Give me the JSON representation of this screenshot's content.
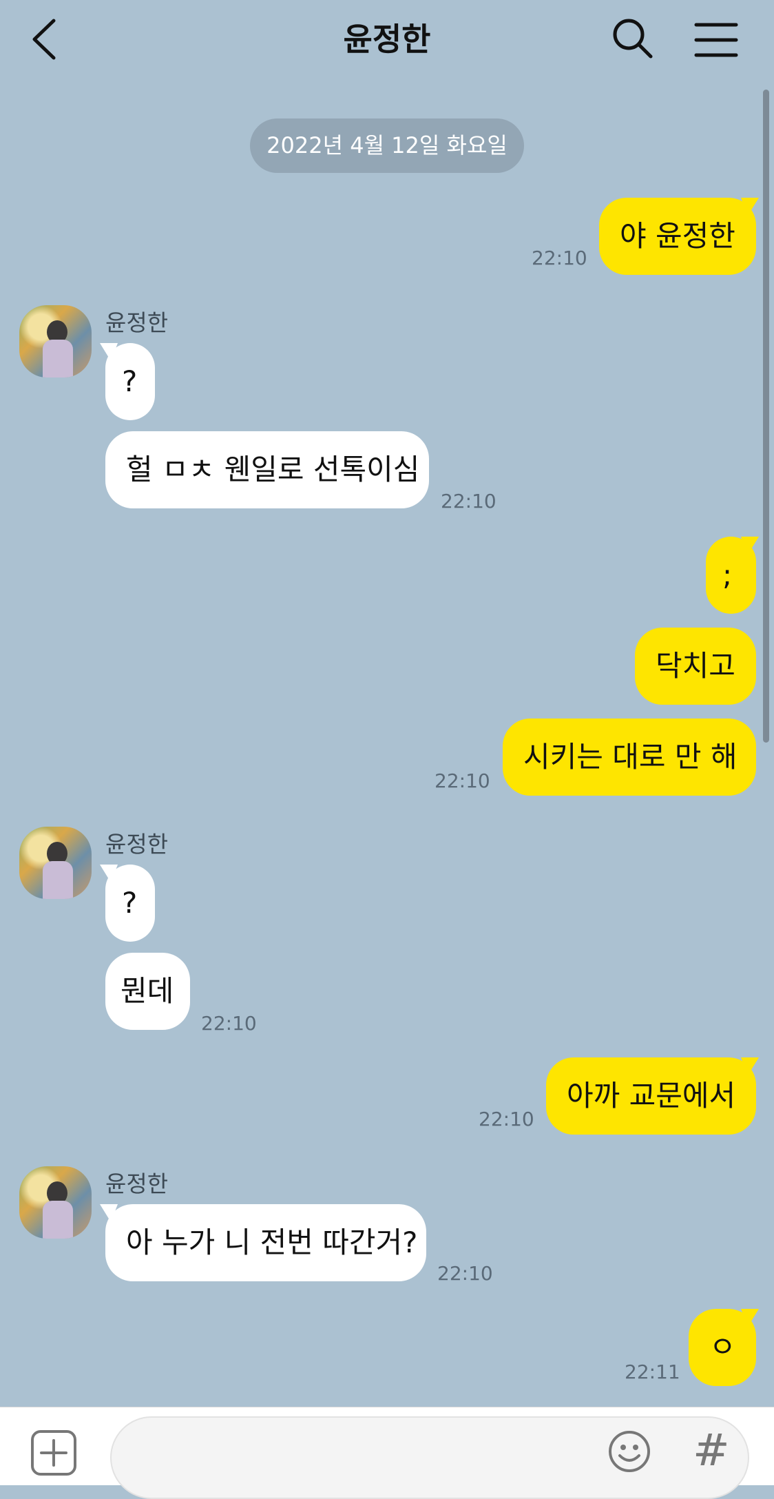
{
  "header": {
    "title": "윤정한",
    "back_icon": "back-chevron-icon",
    "search_icon": "search-icon",
    "menu_icon": "hamburger-menu-icon"
  },
  "date_divider": "2022년 4월 12일 화요일",
  "contact": {
    "name": "윤정한"
  },
  "messages": [
    {
      "from": "me",
      "text": "야 윤정한",
      "time": "22:10"
    },
    {
      "from": "other",
      "text": "?",
      "time": ""
    },
    {
      "from": "other",
      "text": "헐 ㅁㅊ 웬일로 선톡이심",
      "time": "22:10"
    },
    {
      "from": "me",
      "text": ";",
      "time": ""
    },
    {
      "from": "me",
      "text": "닥치고",
      "time": ""
    },
    {
      "from": "me",
      "text": "시키는 대로 만 해",
      "time": "22:10"
    },
    {
      "from": "other",
      "text": "?",
      "time": ""
    },
    {
      "from": "other",
      "text": "뭔데",
      "time": "22:10"
    },
    {
      "from": "me",
      "text": "아까 교문에서",
      "time": "22:10"
    },
    {
      "from": "other",
      "text": "아 누가 니 전번 따간거?",
      "time": "22:10"
    },
    {
      "from": "me",
      "text": "ㅇ",
      "time": "22:11"
    }
  ],
  "input_bar": {
    "plus_icon": "plus-square-icon",
    "placeholder": "",
    "emoji_icon": "emoji-smile-icon",
    "hash_label": "#"
  },
  "colors": {
    "background": "#abc1d1",
    "my_bubble": "#fee500",
    "other_bubble": "#ffffff"
  }
}
